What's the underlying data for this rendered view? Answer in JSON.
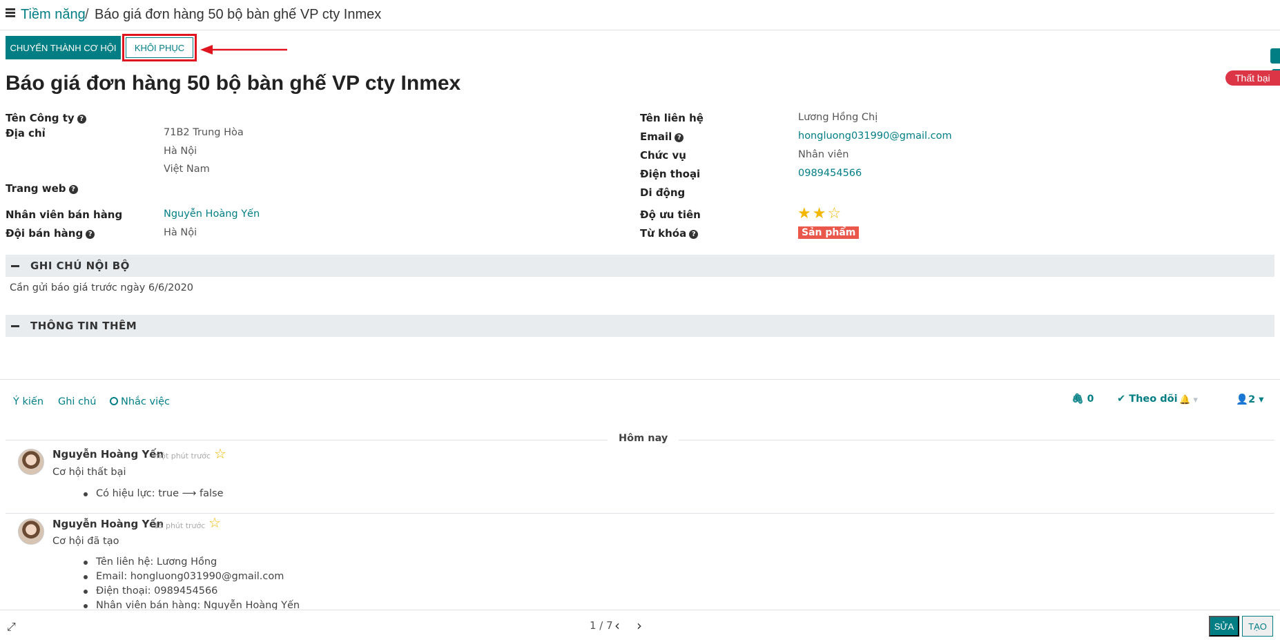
{
  "breadcrumb": {
    "parent": "Tiềm năng",
    "separator": "/",
    "current": "Báo giá đơn hàng 50 bộ bàn ghế VP cty Inmex"
  },
  "buttons": {
    "convert": "CHUYỂN THÀNH CƠ HỘI",
    "restore": "KHÔI PHỤC"
  },
  "ribbon": "Thất bại",
  "title": "Báo giá đơn hàng 50 bộ bàn ghế VP cty Inmex",
  "left_fields": {
    "company_label": "Tên Công ty",
    "address_label": "Địa chỉ",
    "address_street": "71B2 Trung Hòa",
    "address_city": "Hà Nội",
    "address_country": "Việt Nam",
    "website_label": "Trang web",
    "salesperson_label": "Nhân viên bán hàng",
    "salesperson_value": "Nguyễn Hoàng Yến",
    "team_label": "Đội bán hàng",
    "team_value": "Hà Nội"
  },
  "right_fields": {
    "contact_label": "Tên liên hệ",
    "contact_value": "Lương Hồng Chị",
    "email_label": "Email",
    "email_value": "hongluong031990@gmail.com",
    "job_label": "Chức vụ",
    "job_value": "Nhân viên",
    "phone_label": "Điện thoại",
    "phone_value": "0989454566",
    "mobile_label": "Di động",
    "priority_label": "Độ ưu tiên",
    "priority_stars": 2,
    "priority_max": 3,
    "tags_label": "Từ khóa",
    "tag_value": "Sản phẩm"
  },
  "sections": {
    "internal_notes": "GHI CHÚ NỘI BỘ",
    "internal_notes_text": "Cần gửi báo giá trước ngày 6/6/2020",
    "extra_info": "THÔNG TIN THÊM"
  },
  "chatter": {
    "send_message": "Ý kiến",
    "log_note": "Ghi chú",
    "schedule_activity": "Nhắc việc",
    "attachments": "0",
    "follow": "Theo dõi",
    "followers": "2",
    "today": "Hôm nay",
    "messages": [
      {
        "author": "Nguyễn Hoàng Yến",
        "date": "- một phút trước",
        "body": "Cơ hội thất bại",
        "items": [
          "Có hiệu lực: true ⟶ false"
        ]
      },
      {
        "author": "Nguyễn Hoàng Yến",
        "date": "- 15 phút trước",
        "body": "Cơ hội đã tạo",
        "items": [
          "Tên liên hệ: Lương Hồng",
          "Email: hongluong031990@gmail.com",
          "Điện thoại: 0989454566",
          "Nhân viên bán hàng: Nguyễn Hoàng Yến"
        ]
      }
    ]
  },
  "pager": {
    "value": "1 / 7"
  },
  "bottom_buttons": {
    "edit": "SỬA",
    "create": "TẠO"
  },
  "colors": {
    "primary": "#017e84",
    "danger": "#dc3545",
    "tag": "#e9584b",
    "star": "#f3b700"
  },
  "icons": {
    "menu": "hamburger-icon",
    "help": "question-circle-icon",
    "clock": "clock-icon",
    "paperclip": "paperclip-icon",
    "check": "check-icon",
    "bell": "bell-icon",
    "users": "users-icon",
    "expand": "expand-icon",
    "prev": "chevron-left-icon",
    "next": "chevron-right-icon"
  }
}
